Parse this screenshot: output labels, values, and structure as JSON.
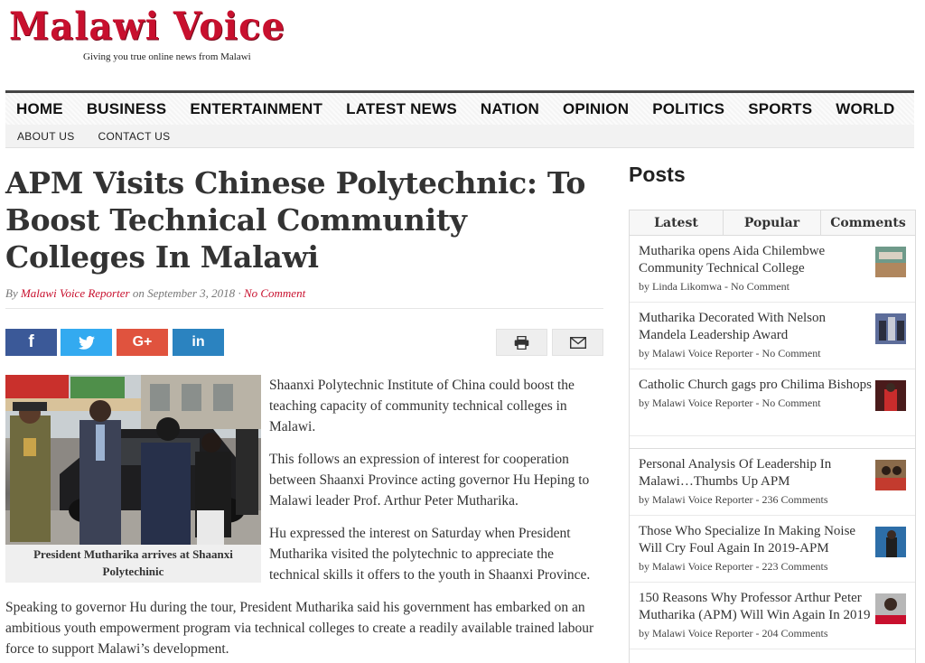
{
  "site": {
    "logo_text": "Malawi Voice",
    "tagline": "Giving you true online news from Malawi"
  },
  "nav": {
    "main": [
      "HOME",
      "BUSINESS",
      "ENTERTAINMENT",
      "LATEST NEWS",
      "NATION",
      "OPINION",
      "POLITICS",
      "SPORTS",
      "WORLD"
    ],
    "sub": [
      "ABOUT US",
      "CONTACT US"
    ]
  },
  "article": {
    "title": "APM Visits Chinese Polytechnic: To Boost Technical Community Colleges In Malawi",
    "byline": {
      "by": "By",
      "author": "Malawi Voice Reporter",
      "on": "on September 3, 2018",
      "sep": "·",
      "comments": "No Comment"
    },
    "share": {
      "facebook": "f",
      "twitter": "t",
      "google": "G+",
      "linkedin": "in"
    },
    "image_caption": "President Mutharika arrives at Shaanxi Polytechinic",
    "paragraphs": [
      "Shaanxi Polytechnic Institute of China could boost the teaching capacity of community technical colleges in Malawi.",
      "This follows an expression of interest for cooperation between Shaanxi Province acting governor Hu Heping to Malawi leader Prof. Arthur Peter Mutharika.",
      "Hu expressed the interest on Saturday when President Mutharika visited the polytechnic to appreciate the technical skills it offers to the youth in Shaanxi Province.",
      "Speaking to governor Hu during the tour, President Mutharika said his government has embarked on an ambitious youth empowerment program via technical colleges to create a readily available trained labour force to support Malawi’s development."
    ]
  },
  "sidebar": {
    "title": "Posts",
    "tabs": [
      "Latest",
      "Popular",
      "Comments"
    ],
    "latest": [
      {
        "title": "Mutharika opens Aida Chilembwe Community Technical College",
        "meta": "by Linda Likomwa - No Comment"
      },
      {
        "title": "Mutharika Decorated With Nelson Mandela Leadership Award",
        "meta": "by Malawi Voice Reporter - No Comment"
      },
      {
        "title": "Catholic Church gags pro Chilima Bishops",
        "meta": "by Malawi Voice Reporter - No Comment"
      }
    ],
    "popular": [
      {
        "title": "Personal Analysis Of Leadership In Malawi…Thumbs Up APM",
        "meta": "by Malawi Voice Reporter - 236 Comments"
      },
      {
        "title": "Those Who Specialize In Making Noise Will Cry Foul Again In 2019-APM",
        "meta": "by Malawi Voice Reporter - 223 Comments"
      },
      {
        "title": "150 Reasons Why Professor Arthur Peter Mutharika (APM) Will Win Again In 2019",
        "meta": "by Malawi Voice Reporter - 204 Comments"
      }
    ]
  },
  "colors": {
    "brand_red": "#c8102e",
    "facebook": "#3b5998",
    "twitter": "#33aaf0",
    "google": "#e0533e",
    "linkedin": "#2b83c0"
  },
  "icons": [
    "facebook-icon",
    "twitter-icon",
    "google-plus-icon",
    "linkedin-icon",
    "print-icon",
    "mail-icon"
  ]
}
